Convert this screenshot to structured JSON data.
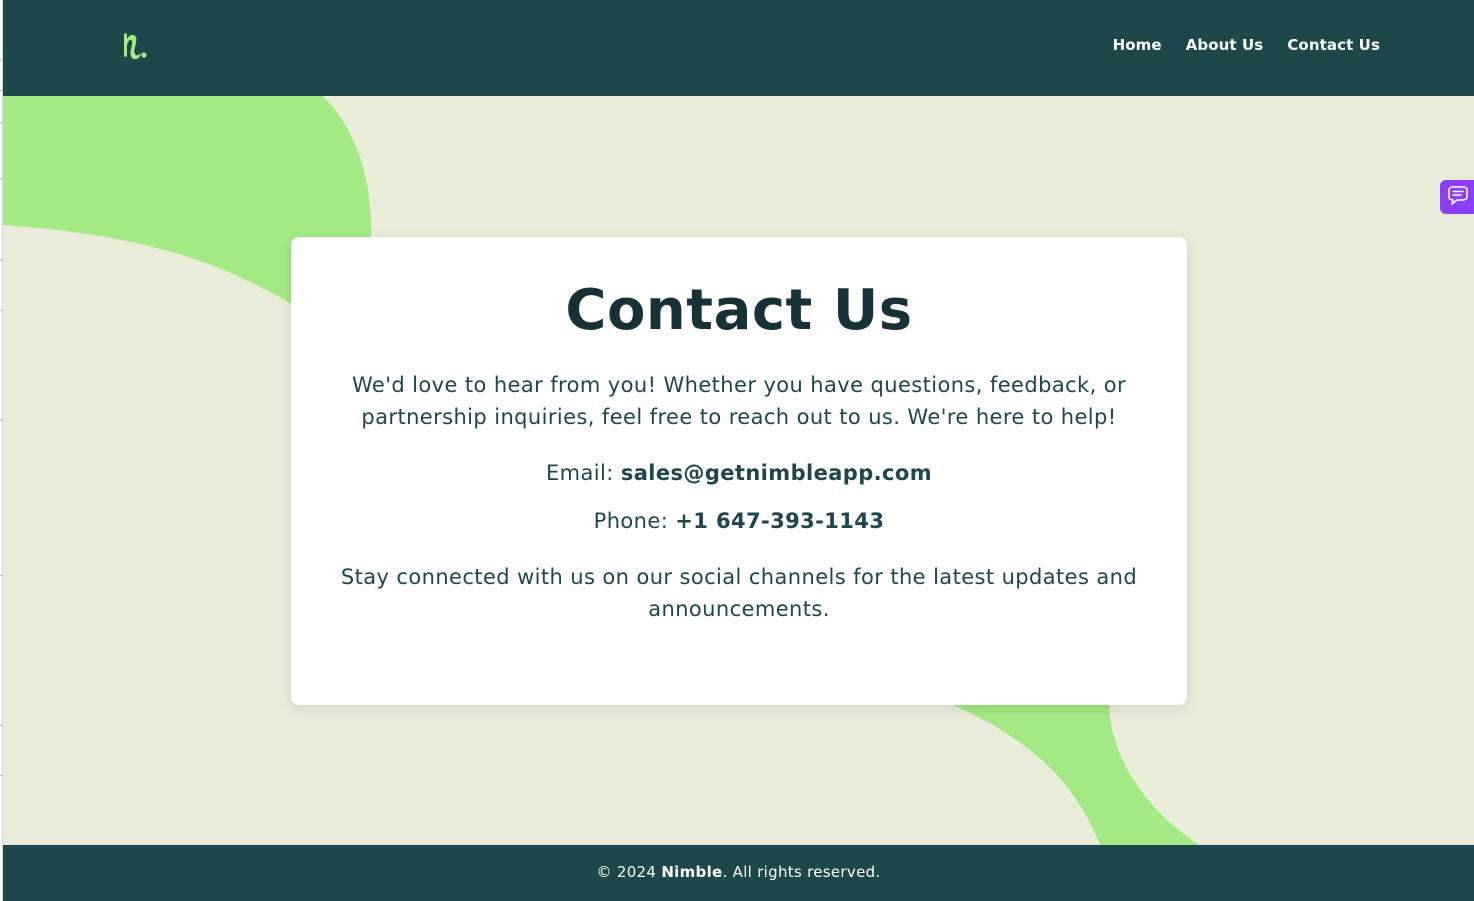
{
  "header": {
    "logo_alt": "Nimble",
    "nav": [
      {
        "label": "Home"
      },
      {
        "label": "About Us"
      },
      {
        "label": "Contact Us"
      }
    ]
  },
  "contact": {
    "title": "Contact Us",
    "intro": "We'd love to hear from you! Whether you have questions, feedback, or partnership inquiries, feel free to reach out to us. We're here to help!",
    "email_label": "Email:",
    "email_value": "sales@getnimbleapp.com",
    "phone_label": "Phone:",
    "phone_value": "+1 647-393-1143",
    "outro": "Stay connected with us on our social channels for the latest updates and announcements."
  },
  "widget": {
    "icon": "chat-bubble-icon",
    "color": "#8a3ffc"
  },
  "footer": {
    "copyright_prefix": "© 2024",
    "brand": "Nimble",
    "copyright_suffix": ". All rights reserved."
  },
  "colors": {
    "brand_dark": "#1e474b",
    "page_bg": "#eaecda",
    "accent_green": "#a3ea84",
    "card_bg": "#ffffff"
  }
}
